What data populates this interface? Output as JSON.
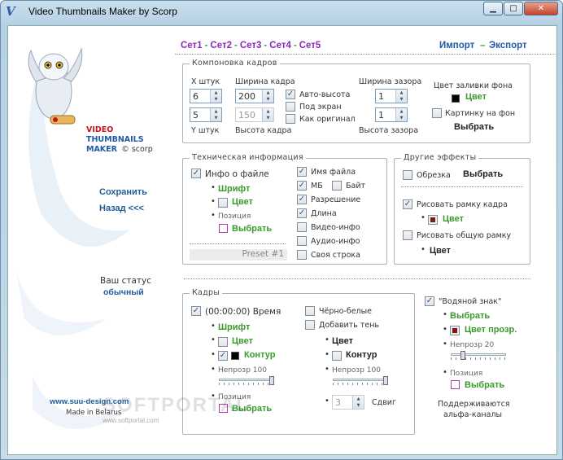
{
  "window": {
    "title": "Video Thumbnails Maker by Scorp",
    "icon": "V",
    "min_label": "▁",
    "max_label": "□",
    "close_label": "✕"
  },
  "brand": {
    "line1": "VIDEO",
    "line2": "THUMBNAILS",
    "line3": "MAKER",
    "copyright": "© scorp"
  },
  "nav": {
    "save": "Сохранить",
    "back": "Назад <<<",
    "status_label": "Ваш статус",
    "status_value": "обычный",
    "site": "www.suu-design.com",
    "made": "Made in Belarus"
  },
  "sets": [
    "Сет1",
    "Сет2",
    "Сет3",
    "Сет4",
    "Сет5"
  ],
  "sets_sep": "-",
  "import": "Импорт",
  "import_sep": "–",
  "export": "Экспорт",
  "layout": {
    "title": "Компоновка кадров",
    "x_label": "X штук",
    "x_value": "6",
    "y_label": "Y штук",
    "y_value": "5",
    "width_label": "Ширина кадра",
    "width_value": "200",
    "height_label": "Высота кадра",
    "height_value": "150",
    "auto_height": "Авто-высота",
    "fit_screen": "Под экран",
    "as_original": "Как оригинал",
    "gap_w_label": "Ширина зазора",
    "gap_w_value": "1",
    "gap_h_label": "Высота зазора",
    "gap_h_value": "1",
    "bg_label": "Цвет заливки фона",
    "bg_color_btn": "Цвет",
    "bg_image": "Картинку на фон",
    "choose": "Выбрать"
  },
  "tech": {
    "title": "Техническая информация",
    "file_info": "Инфо о файле",
    "font": "Шрифт",
    "color": "Цвет",
    "position": "Позиция",
    "choose": "Выбрать",
    "filename": "Имя файла",
    "mb": "МБ",
    "byte": "Байт",
    "resolution": "Разрешение",
    "length": "Длина",
    "video_info": "Видео-инфо",
    "audio_info": "Аудио-инфо",
    "custom": "Своя строка",
    "preset": "Preset #1"
  },
  "effects": {
    "title": "Другие эффекты",
    "crop": "Обрезка",
    "crop_btn": "Выбрать",
    "frame_border": "Рисовать рамку кадра",
    "frame_color": "Цвет",
    "common_border": "Рисовать общую рамку",
    "common_color": "Цвет"
  },
  "frames": {
    "title": "Кадры",
    "time": "(00:00:00) Время",
    "font": "Шрифт",
    "color": "Цвет",
    "outline": "Контур",
    "opacity_label": "Непрозр 100",
    "position": "Позиция",
    "choose": "Выбрать",
    "bw": "Чёрно-белые",
    "shadow": "Добавить тень",
    "shadow_color": "Цвет",
    "shadow_outline": "Контур",
    "shadow_opacity": "Непрозр 100",
    "shift_value": "3",
    "shift": "Сдвиг"
  },
  "watermark": {
    "title": "\"Водяной знак\"",
    "choose": "Выбрать",
    "color": "Цвет прозр.",
    "opacity": "Непрозр 20",
    "position": "Позиция",
    "choose2": "Выбрать",
    "note1": "Поддерживаются",
    "note2": "альфа-каналы"
  },
  "overlay": {
    "portal": "SOFTPORTAL",
    "portal_url": "www.softportal.com"
  },
  "levels": {
    "frames_opacity": 1.0,
    "shadow_opacity": 1.0,
    "watermark_opacity": 0.2
  },
  "colors": {
    "accent_green": "#3a9a2c",
    "sets_purple": "#8b2ab8",
    "link_blue": "#1f5aa8",
    "brand_red": "#c4161c"
  }
}
